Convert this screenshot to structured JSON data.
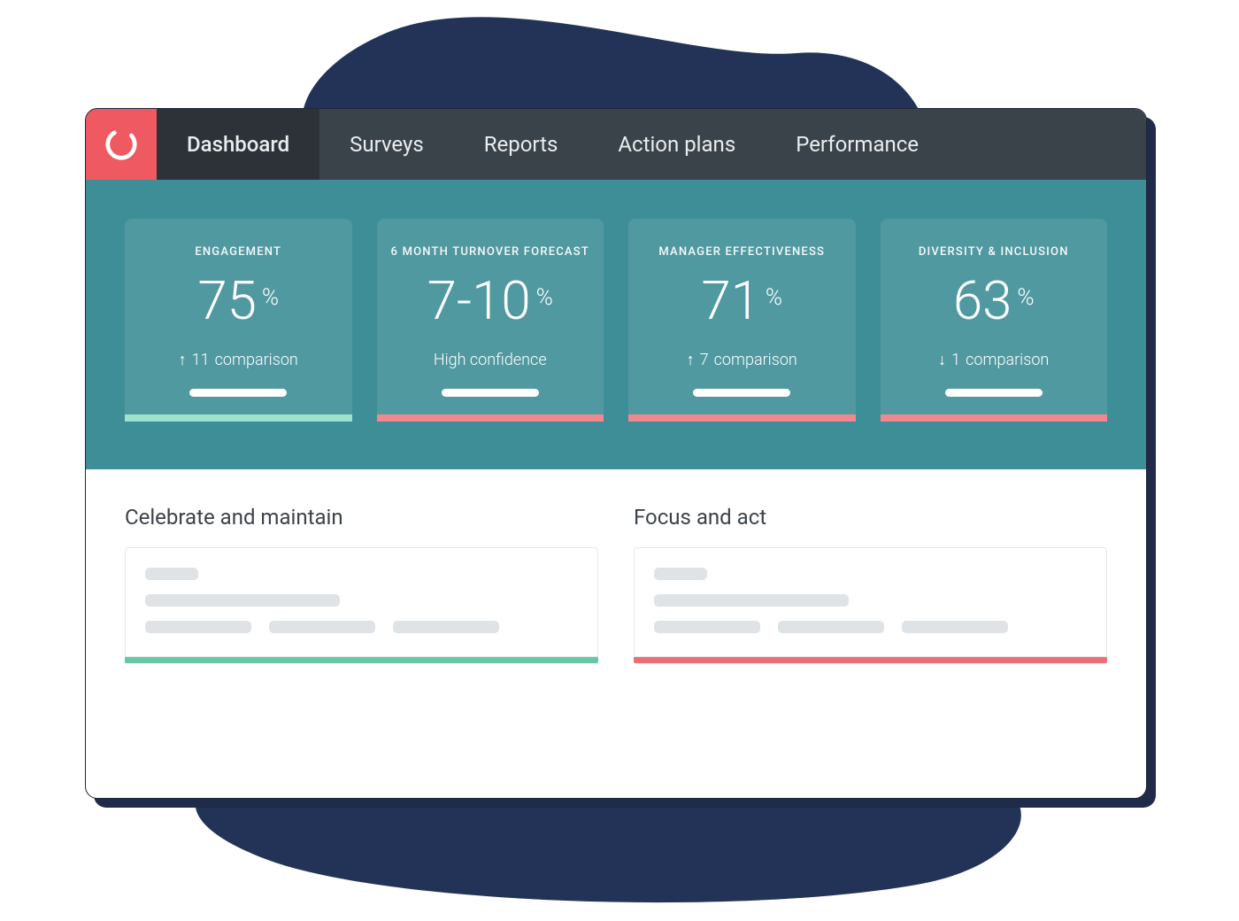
{
  "nav": {
    "items": [
      {
        "label": "Dashboard",
        "active": true
      },
      {
        "label": "Surveys"
      },
      {
        "label": "Reports"
      },
      {
        "label": "Action plans"
      },
      {
        "label": "Performance"
      }
    ]
  },
  "metrics": [
    {
      "title": "ENGAGEMENT",
      "value": "75",
      "unit": "%",
      "arrow": "↑",
      "delta": "11",
      "sub_suffix": "comparison",
      "accent": "green"
    },
    {
      "title": "6 MONTH TURNOVER FORECAST",
      "value": "7-10",
      "unit": "%",
      "sub_plain": "High confidence",
      "accent": "pink"
    },
    {
      "title": "MANAGER EFFECTIVENESS",
      "value": "71",
      "unit": "%",
      "arrow": "↑",
      "delta": "7",
      "sub_suffix": "comparison",
      "accent": "pink"
    },
    {
      "title": "DIVERSITY & INCLUSION",
      "value": "63",
      "unit": "%",
      "arrow": "↓",
      "delta": "1",
      "sub_suffix": "comparison",
      "accent": "pink"
    }
  ],
  "insights": {
    "left_title": "Celebrate and maintain",
    "right_title": "Focus and act"
  },
  "colors": {
    "brand_red": "#ef5961",
    "nav_bg": "#3b434a",
    "nav_active": "#2c3238",
    "band_bg": "#3e8e97",
    "accent_green": "#66c9a6",
    "accent_pink": "#ee6e77"
  }
}
